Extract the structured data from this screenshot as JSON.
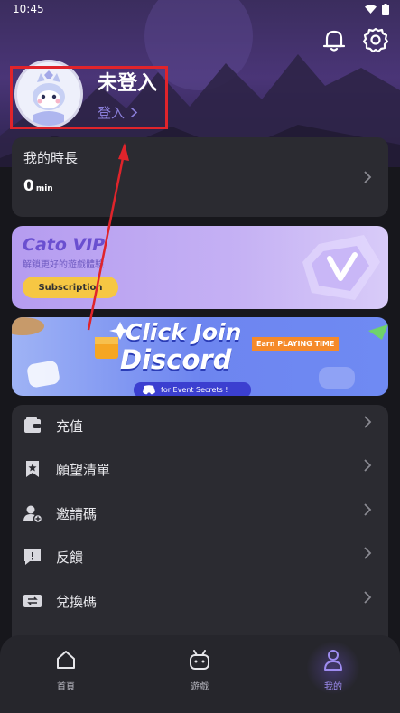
{
  "status": {
    "time": "10:45"
  },
  "profile": {
    "name": "未登入",
    "login_label": "登入"
  },
  "duration": {
    "label": "我的時長",
    "value": "0",
    "unit": "min"
  },
  "vip": {
    "title": "Cato VIP",
    "subtitle": "解鎖更好的遊戲體驗",
    "button": "Subscription"
  },
  "discord_banner": {
    "line1": "Click Join",
    "line2": "Discord",
    "badge": "Earn PLAYING TIME",
    "footer": "for Event Secrets !"
  },
  "menu": [
    {
      "label": "充值",
      "icon": "wallet-icon"
    },
    {
      "label": "願望清單",
      "icon": "bookmark-star-icon"
    },
    {
      "label": "邀請碼",
      "icon": "add-user-icon"
    },
    {
      "label": "反饋",
      "icon": "feedback-icon"
    },
    {
      "label": "兌換碼",
      "icon": "exchange-ticket-icon"
    }
  ],
  "tabs": [
    {
      "label": "首頁",
      "icon": "home-icon"
    },
    {
      "label": "遊戲",
      "icon": "gamepad-icon"
    },
    {
      "label": "我的",
      "icon": "profile-icon",
      "active": true
    }
  ],
  "colors": {
    "accent": "#8b7fdb",
    "highlight": "#e0242b",
    "vip_button": "#f6c743"
  }
}
